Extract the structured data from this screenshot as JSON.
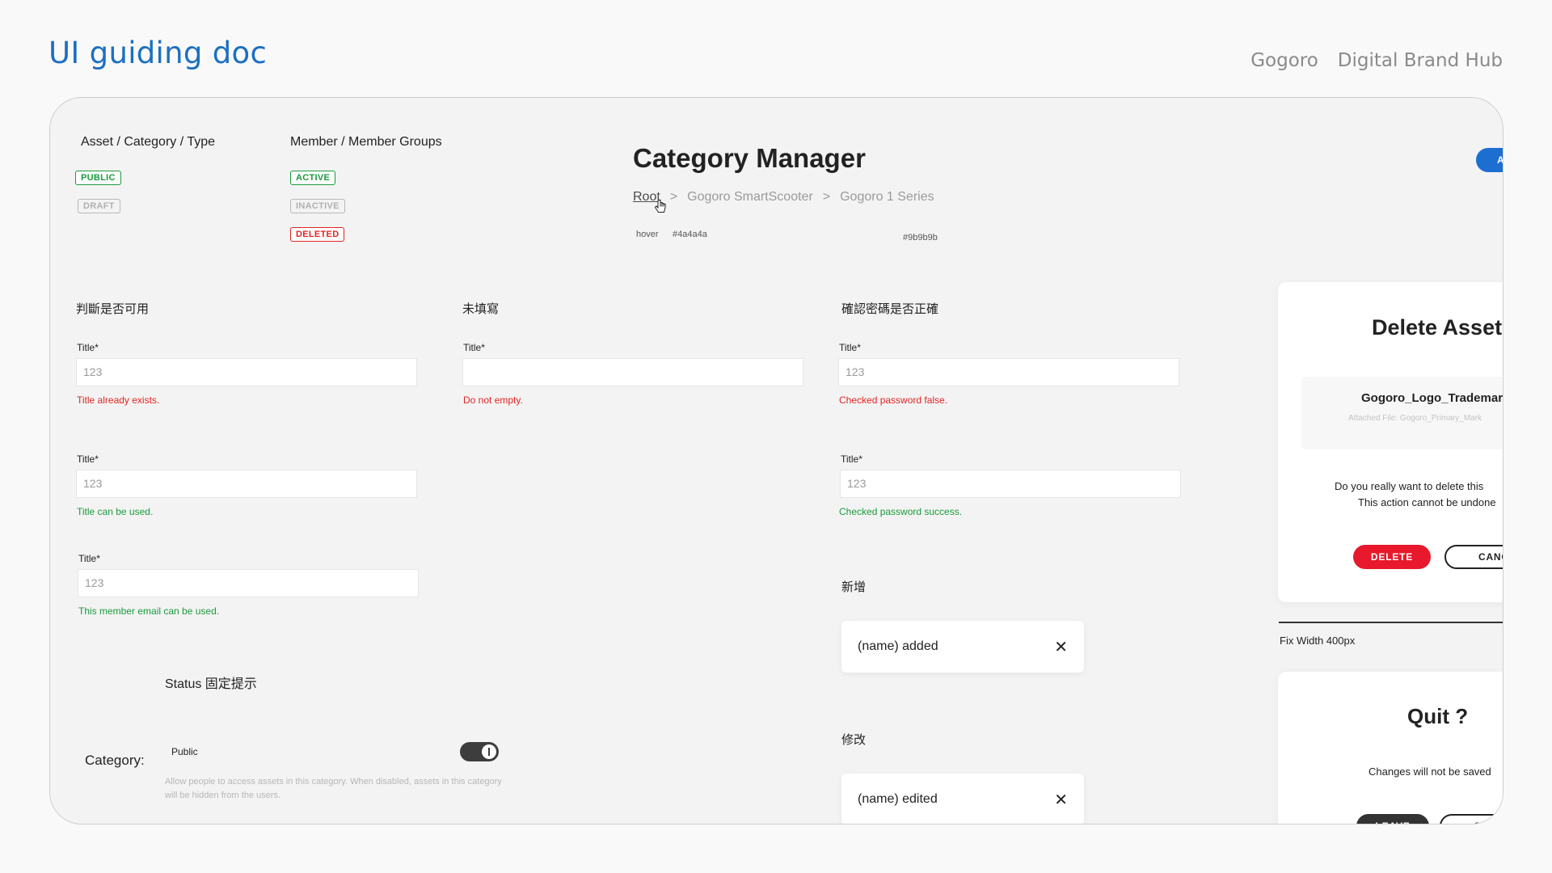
{
  "header": {
    "doc_title": "UI guiding doc",
    "brand": "Gogoro",
    "hub": "Digital Brand Hub"
  },
  "status_badges": {
    "asset_heading": "Asset / Category / Type",
    "member_heading": "Member / Member Groups",
    "asset": [
      "PUBLIC",
      "DRAFT"
    ],
    "member": [
      "ACTIVE",
      "INACTIVE",
      "DELETED"
    ]
  },
  "category_manager": {
    "title": "Category Manager",
    "breadcrumb": [
      "Root",
      "Gogoro SmartScooter",
      "Gogoro 1 Series"
    ],
    "separator": ">",
    "hover_note": "hover",
    "hover_color": "#4a4a4a",
    "default_color": "#9b9b9b",
    "action_button": "A"
  },
  "validation": {
    "col1_heading": "判斷是否可用",
    "col2_heading": "未填寫",
    "col3_heading": "確認密碼是否正確",
    "label": "Title*",
    "value": "123",
    "msg_title_exists": "Title already exists.",
    "msg_title_ok": "Title can be used.",
    "msg_email_ok": "This member email can be used.",
    "msg_not_empty": "Do not empty.",
    "msg_pw_false": "Checked password false.",
    "msg_pw_ok": "Checked password success."
  },
  "status_section": {
    "heading": "Status 固定提示",
    "category_label": "Category:",
    "option": "Public",
    "description": "Allow people to access assets in this category. When disabled, assets in this category will be hidden from the users."
  },
  "toasts": {
    "add_heading": "新增",
    "added": "(name) added",
    "edit_heading": "修改",
    "edited": "(name) edited",
    "close_glyph": "✕"
  },
  "delete_modal": {
    "title": "Delete Asset",
    "file_name": "Gogoro_Logo_Trademark",
    "attached": "Attached File: Gogoro_Primary_Mark",
    "question": "Do you really want to delete this",
    "warning": "This action cannot be undone",
    "delete_label": "DELETE",
    "cancel_label": "CANCEL",
    "width_note": "Fix Width 400px"
  },
  "quit_modal": {
    "title": "Quit ?",
    "message": "Changes will not be saved",
    "leave_label": "LEAVE",
    "cancel_label": "CANCEL"
  }
}
